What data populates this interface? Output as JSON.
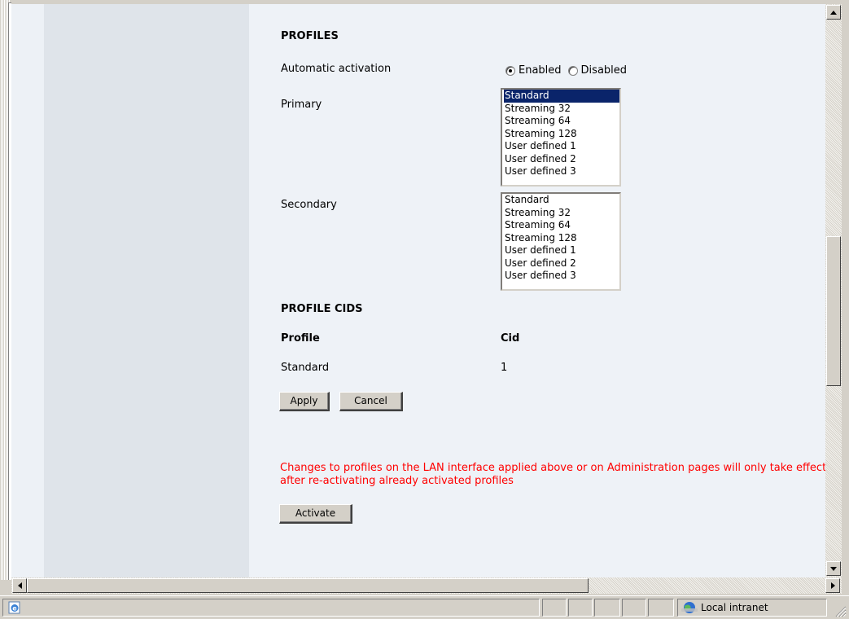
{
  "page": {
    "profiles_heading": "PROFILES",
    "automatic_activation": {
      "label": "Automatic activation",
      "options": [
        "Enabled",
        "Disabled"
      ],
      "selected": "Enabled"
    },
    "primary": {
      "label": "Primary",
      "options": [
        "Standard",
        "Streaming 32",
        "Streaming 64",
        "Streaming 128",
        "User defined 1",
        "User defined 2",
        "User defined 3"
      ],
      "selected": "Standard"
    },
    "secondary": {
      "label": "Secondary",
      "options": [
        "Standard",
        "Streaming 32",
        "Streaming 64",
        "Streaming 128",
        "User defined 1",
        "User defined 2",
        "User defined 3"
      ]
    },
    "profile_cids_heading": "PROFILE CIDS",
    "cid_table": {
      "headers": [
        "Profile",
        "Cid"
      ],
      "rows": [
        [
          "Standard",
          "1"
        ]
      ]
    },
    "apply_label": "Apply",
    "cancel_label": "Cancel",
    "warning": "Changes to profiles on the LAN interface applied above or on Administration pages will only take effect after re-activating already activated profiles",
    "activate_label": "Activate"
  },
  "statusbar": {
    "zone_label": "Local intranet"
  },
  "colors": {
    "selection": "#0a246a",
    "warning": "#ff0000",
    "content_bg": "#eef2f7",
    "side_bg": "#dfe4ea"
  },
  "icons": [
    "ie-page-icon",
    "local-intranet-icon",
    "scroll-up-arrow",
    "scroll-down-arrow",
    "scroll-left-arrow",
    "scroll-right-arrow",
    "resize-grip-icon"
  ]
}
